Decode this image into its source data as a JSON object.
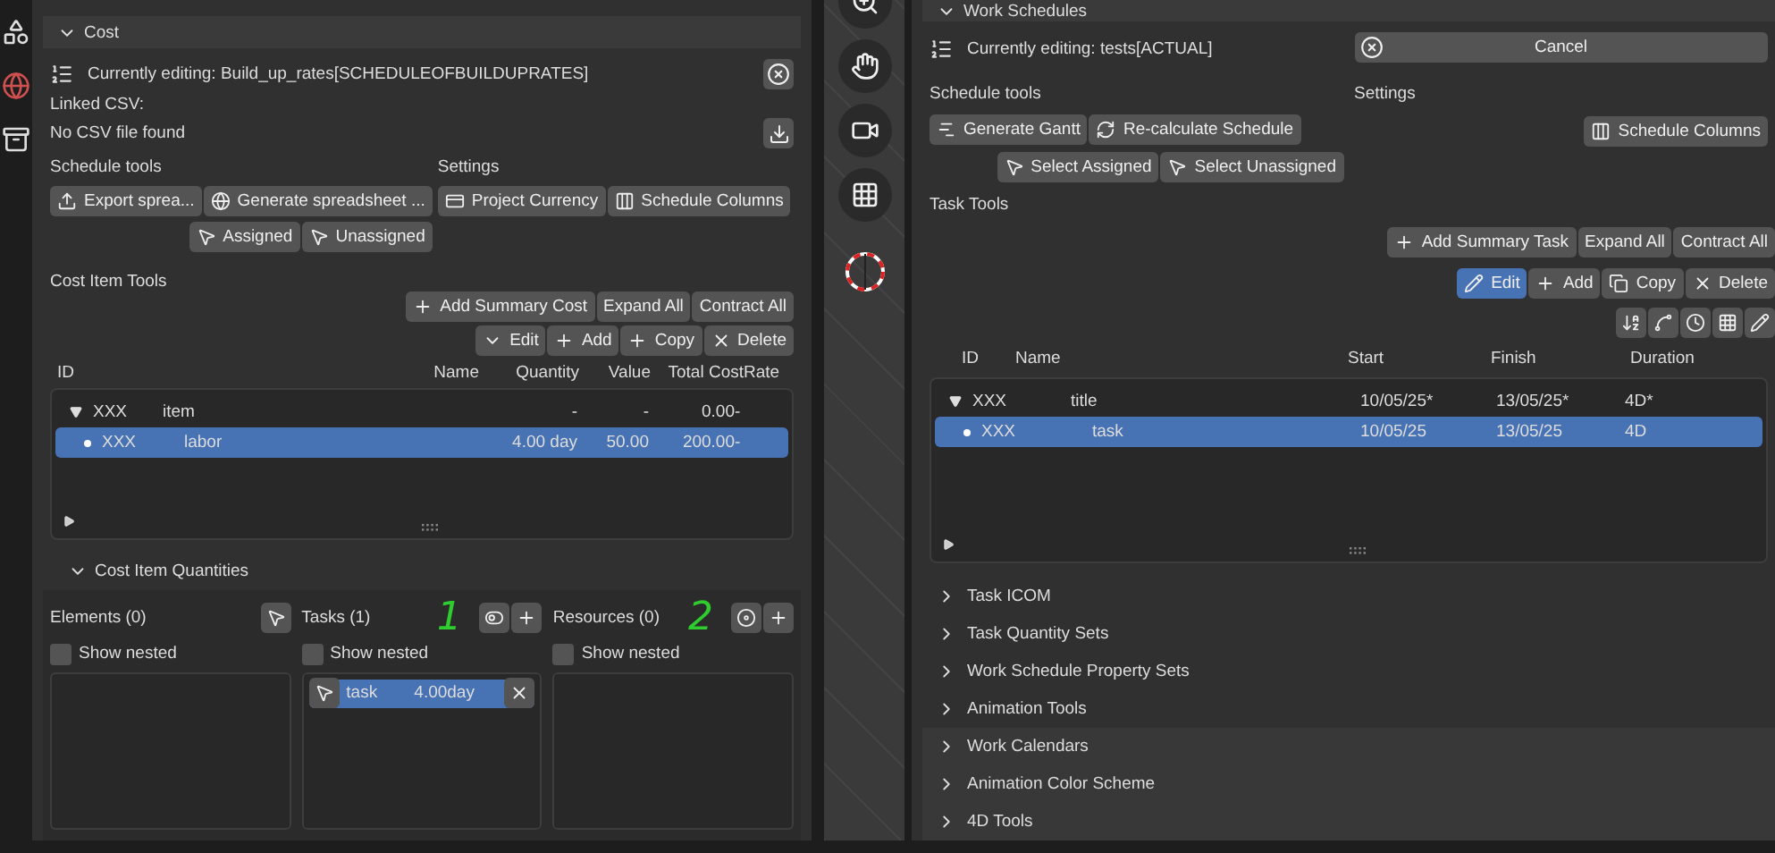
{
  "cost_panel": {
    "title": "Cost",
    "expanded": true,
    "editing": "Currently editing: Build_up_rates[SCHEDULEOFBUILDUPRATES]",
    "linked_csv_label": "Linked CSV:",
    "csv_status": "No CSV file found",
    "schedule_tools": {
      "label": "Schedule tools",
      "row_1": [
        {
          "label": "Export sprea...",
          "kind": "export"
        },
        {
          "label": "Generate spreadsheet ...",
          "kind": "globe"
        }
      ],
      "row_2": [
        {
          "label": "Assigned",
          "kind": "pointer"
        },
        {
          "label": "Unassigned",
          "kind": "pointer"
        }
      ]
    },
    "settings": {
      "label": "Settings",
      "buttons": [
        {
          "label": "Project Currency",
          "kind": "currency"
        },
        {
          "label": "Schedule Columns",
          "kind": "columns"
        }
      ]
    },
    "item_tools": {
      "label": "Cost Item Tools",
      "buttons": [
        {
          "label": "Add Summary Cost",
          "kind": "plus"
        },
        {
          "label": "Expand All",
          "kind": "plain"
        },
        {
          "label": "Contract All",
          "kind": "plain"
        }
      ],
      "edit_row": [
        {
          "label": "Edit",
          "kind": "chevron",
          "selected": false
        },
        {
          "label": "Add",
          "kind": "plus",
          "selected": false
        },
        {
          "label": "Copy",
          "kind": "plus",
          "selected": false
        },
        {
          "label": "Delete",
          "kind": "x",
          "selected": false
        }
      ]
    },
    "table": {
      "columns": [
        "ID",
        "Name",
        "Quantity",
        "Value",
        "Total Cost",
        "Rate"
      ],
      "rows": [
        {
          "id": "XXX",
          "name": "item",
          "quantity": "-",
          "value": "-",
          "total_cost": "0.00",
          "rate": "-",
          "selected": false,
          "expanded": true,
          "children": [
            {
              "id": "XXX",
              "name": "labor",
              "quantity": "4.00 day",
              "value": "50.00",
              "total_cost": "200.00",
              "rate": "-",
              "selected": true
            }
          ]
        }
      ]
    },
    "quantities": {
      "title": "Cost Item Quantities",
      "expanded": true,
      "columns": [
        {
          "title": "Elements (0)",
          "kind": "elements",
          "show_nested": {
            "label": "Show nested",
            "checked": false
          }
        },
        {
          "title": "Tasks (1)",
          "kind": "tasks",
          "annotation": "1",
          "show_nested": {
            "label": "Show nested",
            "checked": false
          },
          "items": [
            {
              "name": "task",
              "quantity": "4.00day",
              "selected": true
            }
          ]
        },
        {
          "title": "Resources (0)",
          "kind": "resources",
          "annotation": "2",
          "show_nested": {
            "label": "Show nested",
            "checked": false
          }
        }
      ]
    }
  },
  "schedule_panel": {
    "title": "Work Schedules",
    "expanded": true,
    "editing": "Currently editing: tests[ACTUAL]",
    "cancel": "Cancel",
    "schedule_tools": {
      "label": "Schedule tools",
      "row_1": [
        {
          "label": "Generate Gantt",
          "kind": "gantt"
        },
        {
          "label": "Re-calculate Schedule",
          "kind": "refresh"
        }
      ],
      "row_2": [
        {
          "label": "Select Assigned",
          "kind": "pointer"
        },
        {
          "label": "Select Unassigned",
          "kind": "pointer"
        }
      ]
    },
    "settings": {
      "label": "Settings",
      "buttons": [
        {
          "label": "Schedule Columns",
          "kind": "columns"
        }
      ]
    },
    "task_tools": {
      "label": "Task Tools",
      "buttons": [
        {
          "label": "Add Summary Task",
          "kind": "plus"
        },
        {
          "label": "Expand All",
          "kind": "plain"
        },
        {
          "label": "Contract All",
          "kind": "plain"
        }
      ],
      "edit_row": [
        {
          "label": "Edit",
          "kind": "pencil",
          "selected": true
        },
        {
          "label": "Add",
          "kind": "plus",
          "selected": false
        },
        {
          "label": "Copy",
          "kind": "copy",
          "selected": false
        },
        {
          "label": "Delete",
          "kind": "x",
          "selected": false
        }
      ]
    },
    "table": {
      "columns": [
        "ID",
        "Name",
        "Start",
        "Finish",
        "Duration"
      ],
      "rows": [
        {
          "id": "XXX",
          "name": "title",
          "start": "10/05/25*",
          "finish": "13/05/25*",
          "duration": "4D*",
          "selected": false,
          "expanded": true,
          "children": [
            {
              "id": "XXX",
              "name": "task",
              "start": "10/05/25",
              "finish": "13/05/25",
              "duration": "4D",
              "selected": true
            }
          ]
        }
      ]
    },
    "sections": [
      {
        "title": "Task ICOM",
        "expanded": false
      },
      {
        "title": "Task Quantity Sets",
        "expanded": false
      },
      {
        "title": "Work Schedule Property Sets",
        "expanded": false
      },
      {
        "title": "Animation Tools",
        "expanded": false
      },
      {
        "title": "Work Calendars",
        "expanded": false
      },
      {
        "title": "Animation Color Scheme",
        "expanded": false
      },
      {
        "title": "4D Tools",
        "expanded": false
      }
    ]
  }
}
